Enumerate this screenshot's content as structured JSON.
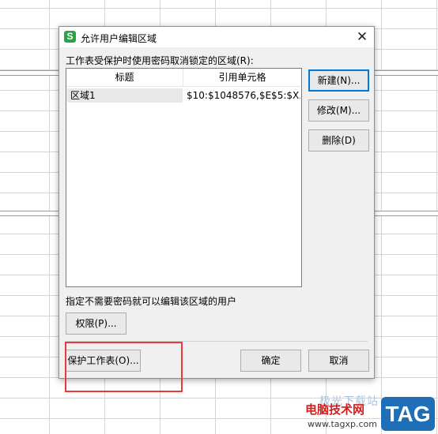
{
  "dialog": {
    "title": "允许用户编辑区域",
    "close_symbol": "✕",
    "app_icon_letter": "S",
    "app_icon_color": "#2aa34b",
    "list_label": "工作表受保护时使用密码取消锁定的区域(R):",
    "columns": [
      "标题",
      "引用单元格"
    ],
    "rows": [
      {
        "title": "区域1",
        "ref": "$10:$1048576,$E$5:$X..."
      }
    ],
    "buttons": {
      "new": "新建(N)...",
      "modify": "修改(M)...",
      "delete": "删除(D)",
      "permissions": "权限(P)...",
      "protect_sheet": "保护工作表(O)...",
      "ok": "确定",
      "cancel": "取消"
    },
    "users_label": "指定不需要密码就可以编辑该区域的用户"
  },
  "annotation": {
    "color": "#e83a3a"
  },
  "watermark": {
    "faint_text": "极光下载站",
    "site_name": "电脑技术网",
    "url": "www.tagxp.com",
    "tag": "TAG",
    "tag_color": "#1f6fb8"
  }
}
